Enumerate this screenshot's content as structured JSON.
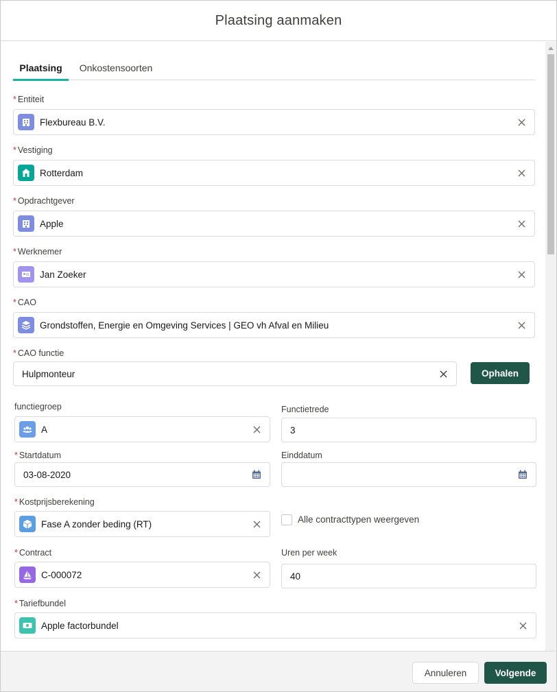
{
  "modal": {
    "title": "Plaatsing aanmaken"
  },
  "tabs": [
    {
      "label": "Plaatsing",
      "active": true
    },
    {
      "label": "Onkostensoorten",
      "active": false
    }
  ],
  "required_marker": "*",
  "fields": {
    "entiteit": {
      "label": "Entiteit",
      "value": "Flexbureau B.V.",
      "icon": "building-icon",
      "icon_color": "#7f8de1"
    },
    "vestiging": {
      "label": "Vestiging",
      "value": "Rotterdam",
      "icon": "home-icon",
      "icon_color": "#04a698"
    },
    "opdrachtgever": {
      "label": "Opdrachtgever",
      "value": "Apple",
      "icon": "building-icon",
      "icon_color": "#7f8de1"
    },
    "werknemer": {
      "label": "Werknemer",
      "value": "Jan Zoeker",
      "icon": "contact-card-icon",
      "icon_color": "#a094ed"
    },
    "cao": {
      "label": "CAO",
      "value": "Grondstoffen, Energie en Omgeving Services | GEO vh Afval en Milieu",
      "icon": "layers-icon",
      "icon_color": "#7f8de1"
    },
    "cao_functie": {
      "label": "CAO functie",
      "value": "Hulpmonteur"
    },
    "functiegroep": {
      "label": "functiegroep",
      "value": "A",
      "icon": "group-icon",
      "icon_color": "#6b9ee6"
    },
    "functietrede": {
      "label": "Functietrede",
      "value": "3"
    },
    "startdatum": {
      "label": "Startdatum",
      "value": "03-08-2020"
    },
    "einddatum": {
      "label": "Einddatum",
      "value": ""
    },
    "kostprijsberekening": {
      "label": "Kostprijsberekening",
      "value": "Fase A zonder beding (RT)",
      "icon": "box-icon",
      "icon_color": "#5c9ee4"
    },
    "alle_contracttypen": {
      "label": "Alle contracttypen weergeven",
      "checked": false
    },
    "contract": {
      "label": "Contract",
      "value": "C-000072",
      "icon": "sailboat-icon",
      "icon_color": "#9668e3"
    },
    "uren_per_week": {
      "label": "Uren per week",
      "value": "40"
    },
    "tariefbundel": {
      "label": "Tariefbundel",
      "value": "Apple factorbundel",
      "icon": "money-icon",
      "icon_color": "#3ec2b0"
    }
  },
  "buttons": {
    "ophalen": "Ophalen",
    "annuleren": "Annuleren",
    "volgende": "Volgende"
  },
  "colors": {
    "brand": "#1f5648",
    "tab_active_underline": "#1bb0a0",
    "required": "#c23934"
  }
}
